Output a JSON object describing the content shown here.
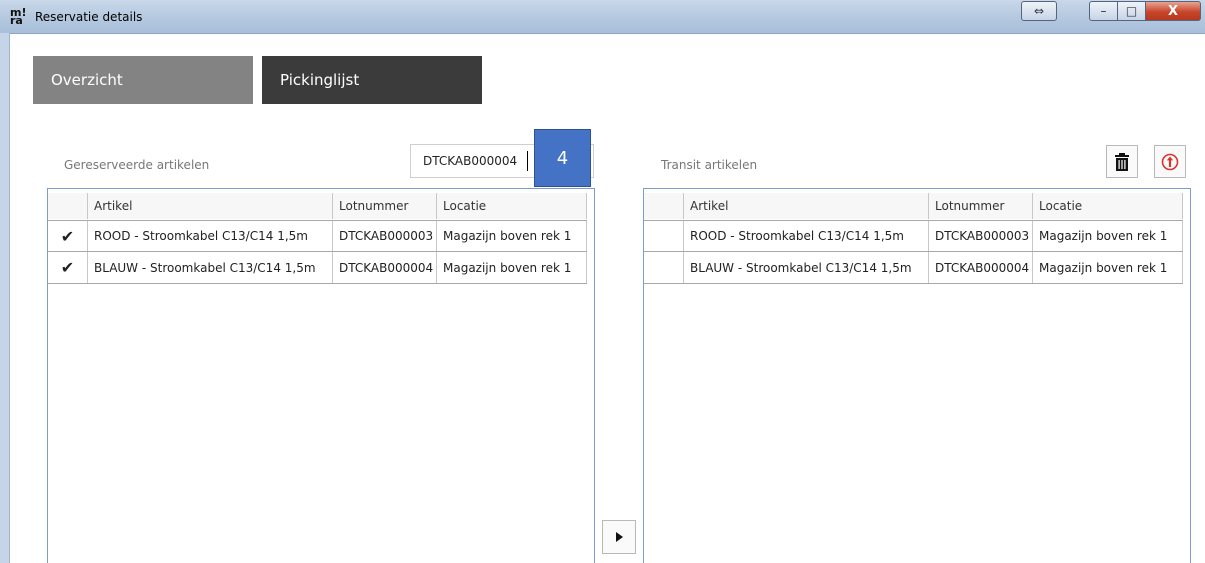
{
  "window": {
    "title": "Reservatie details",
    "resize_glyph": "⇔",
    "minimize_glyph": "–",
    "maximize_glyph": "□",
    "close_glyph": "X"
  },
  "tabs": [
    {
      "label": "Overzicht",
      "active": false
    },
    {
      "label": "Pickinglijst",
      "active": true
    }
  ],
  "reserved": {
    "label": "Gereserveerde artikelen",
    "search_value": "DTCKAB000004",
    "step_badge": "4",
    "columns": [
      "",
      "Artikel",
      "Lotnummer",
      "Locatie"
    ],
    "rows": [
      {
        "check": "✔",
        "artikel": "ROOD - Stroomkabel C13/C14 1,5m",
        "lotnummer": "DTCKAB000003",
        "locatie": "Magazijn boven rek 1"
      },
      {
        "check": "✔",
        "artikel": "BLAUW - Stroomkabel C13/C14 1,5m",
        "lotnummer": "DTCKAB000004",
        "locatie": "Magazijn boven rek 1"
      }
    ]
  },
  "transit": {
    "label": "Transit artikelen",
    "columns": [
      "",
      "Artikel",
      "Lotnummer",
      "Locatie"
    ],
    "rows": [
      {
        "check": "",
        "artikel": "ROOD - Stroomkabel C13/C14 1,5m",
        "lotnummer": "DTCKAB000003",
        "locatie": "Magazijn boven rek 1"
      },
      {
        "check": "",
        "artikel": "BLAUW - Stroomkabel C13/C14 1,5m",
        "lotnummer": "DTCKAB000004",
        "locatie": "Magazijn boven rek 1"
      }
    ]
  },
  "icons": {
    "trash": "trash-icon",
    "upload": "upload-icon",
    "move": "play-arrow-icon"
  },
  "colors": {
    "tab_inactive": "#838383",
    "tab_active": "#3b3b3b",
    "badge": "#4472c4",
    "upload_accent": "#d9342b",
    "panel_border": "#7e9cc8"
  }
}
